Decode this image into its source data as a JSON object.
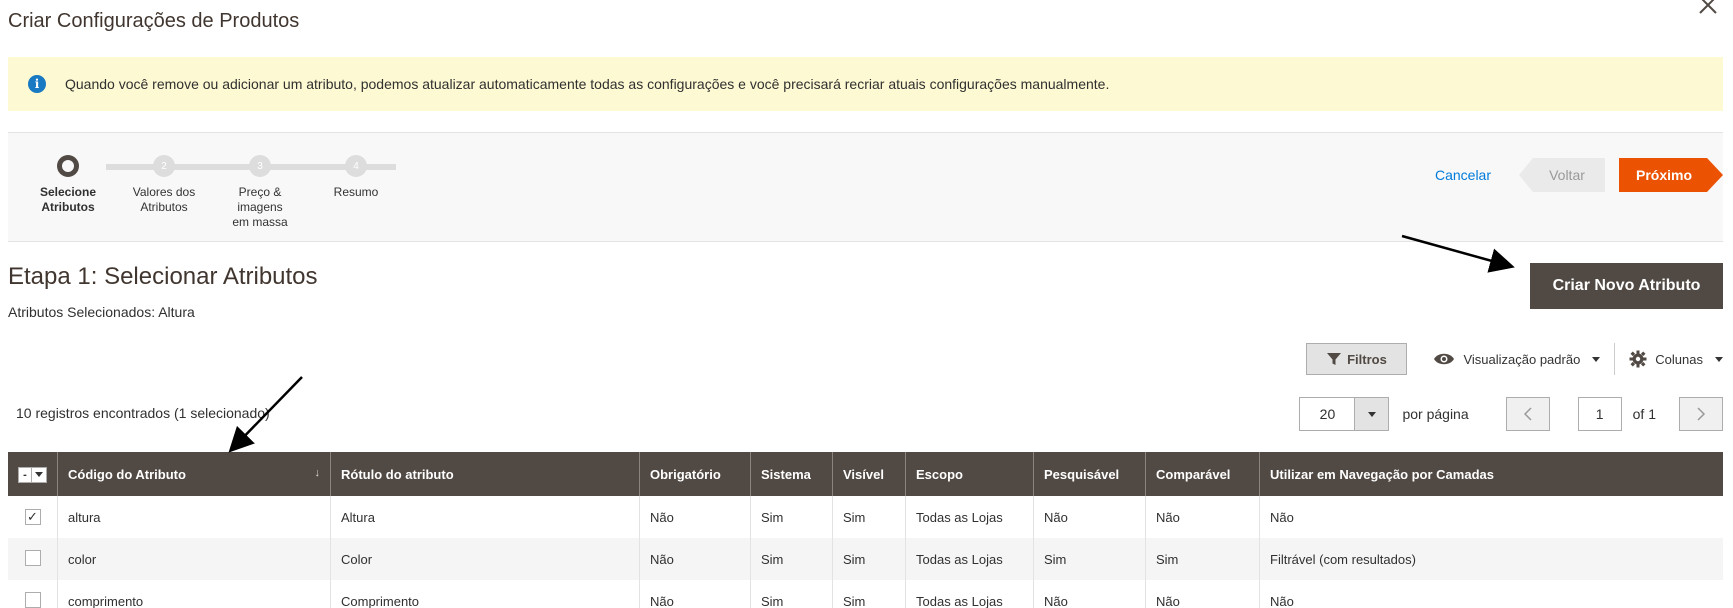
{
  "modal": {
    "title": "Criar Configurações de Produtos"
  },
  "notice": {
    "icon": "info-icon",
    "text": "Quando você remove ou adicionar um atributo, podemos atualizar automaticamente todas as configurações e você precisará recriar atuais configurações manualmente."
  },
  "wizard": {
    "steps": [
      {
        "number": "1",
        "label": "Selecione Atributos",
        "active": true
      },
      {
        "number": "2",
        "label": "Valores dos Atributos",
        "active": false
      },
      {
        "number": "3",
        "label": "Preço & imagens em massa",
        "active": false
      },
      {
        "number": "4",
        "label": "Resumo",
        "active": false
      }
    ],
    "cancel_label": "Cancelar",
    "back_label": "Voltar",
    "next_label": "Próximo"
  },
  "step_title": "Etapa 1: Selecionar Atributos",
  "selected_attributes": "Atributos Selecionados: Altura",
  "create_attribute_label": "Criar Novo Atributo",
  "toolbar": {
    "filters_label": "Filtros",
    "view_label": "Visualização padrão",
    "columns_label": "Colunas"
  },
  "records_text": "10 registros encontrados (1 selecionado)",
  "pager": {
    "per_page_value": "20",
    "per_page_label": "por página",
    "current_page": "1",
    "of_label": "of 1"
  },
  "table": {
    "mass_select_label": "-",
    "columns": [
      "Código do Atributo",
      "Rótulo do atributo",
      "Obrigatório",
      "Sistema",
      "Visível",
      "Escopo",
      "Pesquisável",
      "Comparável",
      "Utilizar em Navegação por Camadas"
    ],
    "sort_indicator": "↓",
    "rows": [
      {
        "checked": true,
        "cells": [
          "altura",
          "Altura",
          "Não",
          "Sim",
          "Sim",
          "Todas as Lojas",
          "Não",
          "Não",
          "Não"
        ]
      },
      {
        "checked": false,
        "cells": [
          "color",
          "Color",
          "Não",
          "Sim",
          "Sim",
          "Todas as Lojas",
          "Sim",
          "Sim",
          "Filtrável (com resultados)"
        ]
      },
      {
        "checked": false,
        "cells": [
          "comprimento",
          "Comprimento",
          "Não",
          "Sim",
          "Sim",
          "Todas as Lojas",
          "Não",
          "Não",
          "Não"
        ]
      }
    ]
  },
  "colors": {
    "accent_orange": "#eb5202",
    "header_dark": "#514943",
    "notice_bg": "#fdf9d2",
    "link_blue": "#007bdb"
  }
}
